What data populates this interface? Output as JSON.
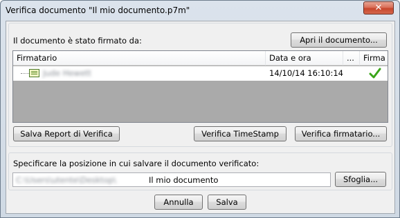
{
  "window": {
    "title": "Verifica documento \"Il mio documento.p7m\"",
    "close_glyph": "✕"
  },
  "signers_group": {
    "heading": "Il documento è stato firmato da:",
    "open_button": "Apri il documento...",
    "columns": [
      "Firmatario",
      "Data e ora",
      "...",
      "Firma"
    ],
    "rows": [
      {
        "signer": "Jude Hewett",
        "datetime": "14/10/14 16:10:14",
        "signature_icon": "green-checkmark-icon"
      }
    ],
    "buttons": {
      "save_report": "Salva Report di Verifica",
      "verify_timestamp": "Verifica TimeStamp",
      "verify_signer": "Verifica firmatario..."
    }
  },
  "save_group": {
    "heading": "Specificare la posizione in cui salvare il documento verificato:",
    "path_prefix": "C:\\Users\\utente\\Desktop\\",
    "path_filename": "Il mio documento",
    "browse_button": "Sfoglia..."
  },
  "footer": {
    "cancel_button": "Annulla",
    "save_button": "Salva"
  },
  "colors": {
    "title_bar": "#dbe3ec",
    "close_button": "#c7462c",
    "table_empty_area": "#aaaaaa",
    "check": "#3aa51a"
  }
}
